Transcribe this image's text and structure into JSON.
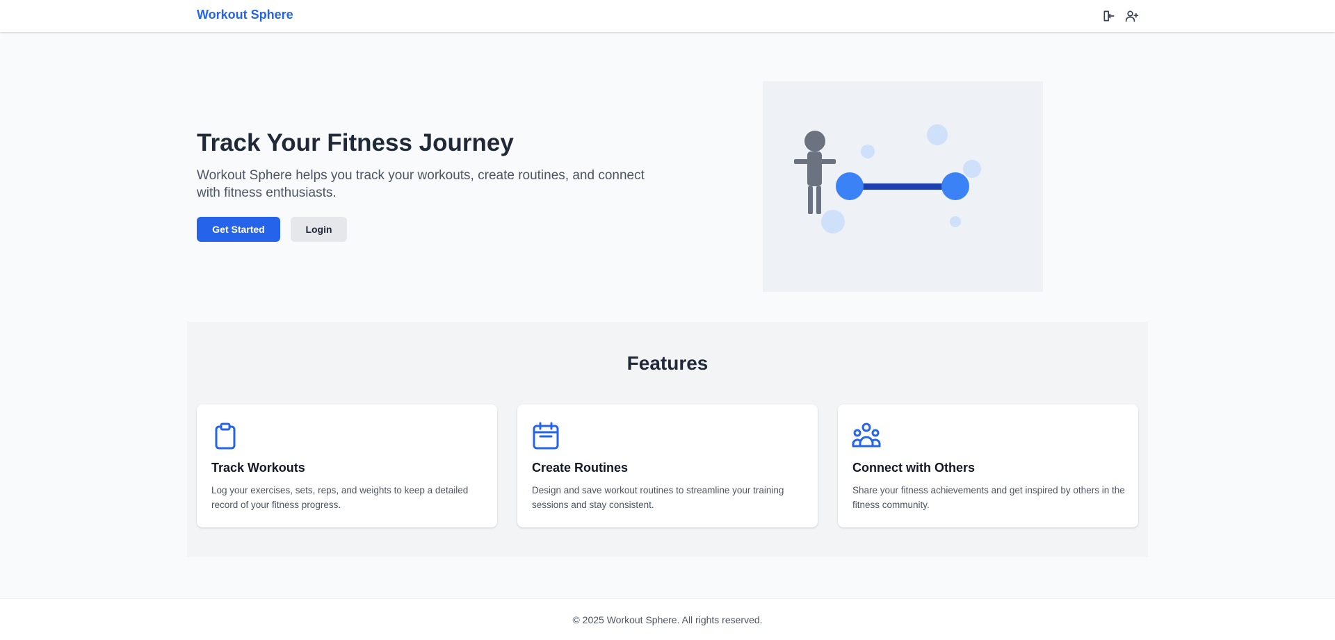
{
  "header": {
    "brand": "Workout Sphere",
    "icons": [
      "login-icon",
      "user-plus-icon"
    ]
  },
  "hero": {
    "title": "Track Your Fitness Journey",
    "subtitle": "Workout Sphere helps you track your workouts, create routines, and connect with fitness enthusiasts.",
    "primary_button": "Get Started",
    "secondary_button": "Login"
  },
  "features": {
    "title": "Features",
    "cards": [
      {
        "icon": "clipboard-icon",
        "title": "Track Workouts",
        "description": "Log your exercises, sets, reps, and weights to keep a detailed record of your fitness progress."
      },
      {
        "icon": "calendar-icon",
        "title": "Create Routines",
        "description": "Design and save workout routines to streamline your training sessions and stay consistent."
      },
      {
        "icon": "users-icon",
        "title": "Connect with Others",
        "description": "Share your fitness achievements and get inspired by others in the fitness community."
      }
    ]
  },
  "footer": {
    "copyright": "© 2025 Workout Sphere. All rights reserved."
  },
  "colors": {
    "brand": "#2563eb",
    "text_dark": "#1f2937",
    "text_muted": "#4b5563",
    "page_bg": "#f8fafc",
    "section_bg": "#f3f4f6"
  }
}
